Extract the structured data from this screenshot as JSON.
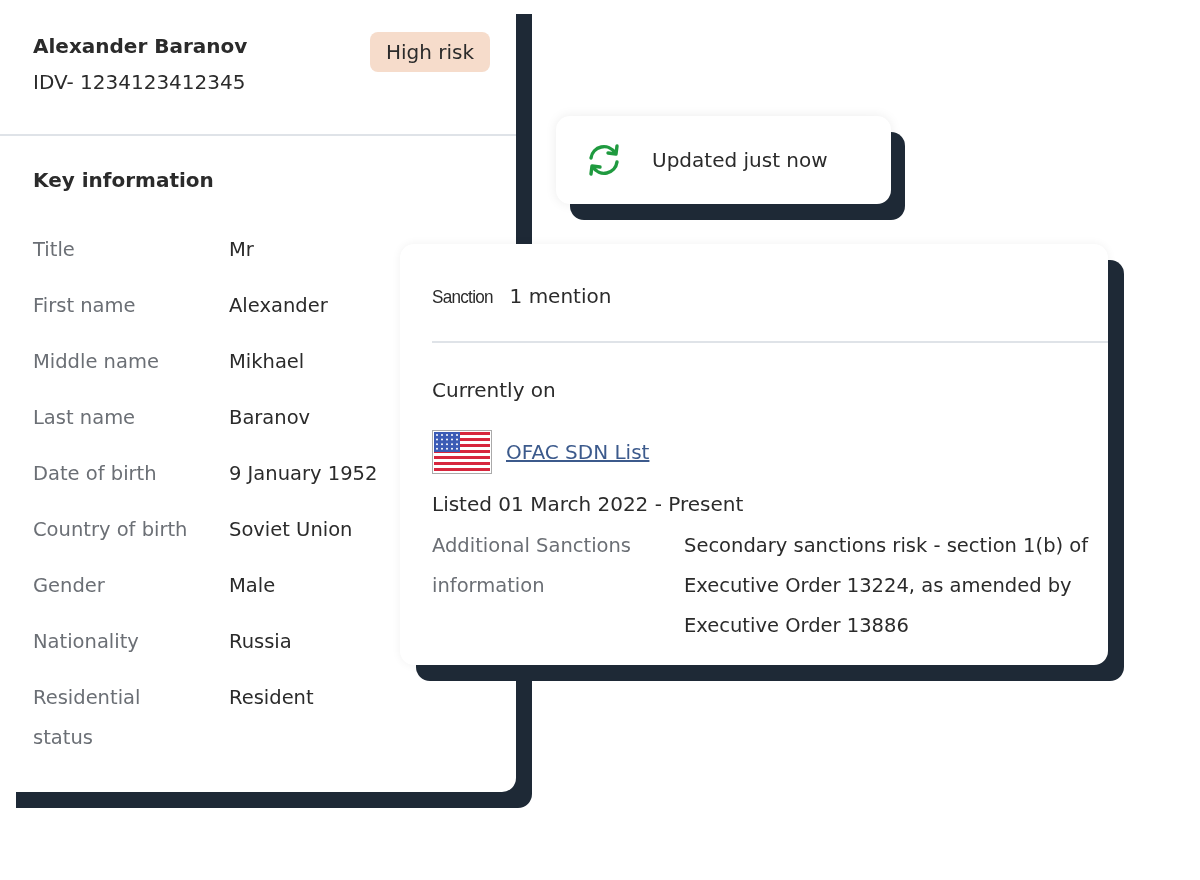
{
  "profile": {
    "name": "Alexander Baranov",
    "id": "IDV- 1234123412345",
    "risk": {
      "label": "High risk",
      "kind": "high"
    },
    "section_title": "Key information",
    "fields": [
      {
        "label": "Title",
        "value": "Mr"
      },
      {
        "label": "First name",
        "value": "Alexander"
      },
      {
        "label": "Middle name",
        "value": "Mikhael"
      },
      {
        "label": "Last name",
        "value": "Baranov"
      },
      {
        "label": "Date of birth",
        "value": "9 January 1952"
      },
      {
        "label": "Country of birth",
        "value": "Soviet Union"
      },
      {
        "label": "Gender",
        "value": "Male"
      },
      {
        "label": "Nationality",
        "value": "Russia"
      },
      {
        "label": "Residential status",
        "value": "Resident"
      }
    ]
  },
  "update_status": {
    "label": "Updated just now"
  },
  "sanction": {
    "category": "Sanction",
    "count": "1 mention",
    "currently_on_label": "Currently on",
    "lists": [
      {
        "name": "OFAC SDN List",
        "listed": "Listed 01 March 2022 - Present"
      }
    ],
    "additional": {
      "label": "Additional Sanctions information",
      "value": "Secondary sanctions risk - section 1(b) of Executive Order 13224, as amended by Executive Order 13886"
    }
  }
}
